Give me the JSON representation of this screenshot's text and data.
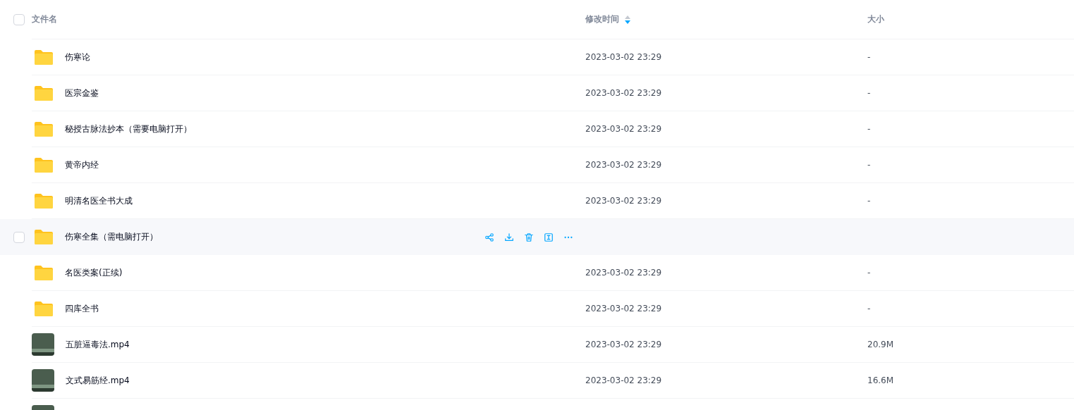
{
  "header": {
    "select_all_checked": false,
    "columns": [
      {
        "label": "文件名"
      },
      {
        "label": "修改时间",
        "sorted_descending": true
      },
      {
        "label": "大小"
      }
    ]
  },
  "rows": [
    {
      "kind": "folder",
      "name": "伤寒论",
      "modified": "2023-03-02 23:29",
      "size": "-",
      "hovered": false
    },
    {
      "kind": "folder",
      "name": "医宗金鉴",
      "modified": "2023-03-02 23:29",
      "size": "-",
      "hovered": false
    },
    {
      "kind": "folder",
      "name": "秘授古脉法抄本（需要电脑打开）",
      "modified": "2023-03-02 23:29",
      "size": "-",
      "hovered": false
    },
    {
      "kind": "folder",
      "name": "黄帝内经",
      "modified": "2023-03-02 23:29",
      "size": "-",
      "hovered": false
    },
    {
      "kind": "folder",
      "name": "明清名医全书大成",
      "modified": "2023-03-02 23:29",
      "size": "-",
      "hovered": false
    },
    {
      "kind": "folder",
      "name": "伤寒全集（需电脑打开）",
      "hovered": true,
      "checked": false
    },
    {
      "kind": "folder",
      "name": "名医类案(正续)",
      "modified": "2023-03-02 23:29",
      "size": "-",
      "hovered": false
    },
    {
      "kind": "folder",
      "name": "四库全书",
      "modified": "2023-03-02 23:29",
      "size": "-",
      "hovered": false
    },
    {
      "kind": "video",
      "name": "五脏逼毒法.mp4",
      "modified": "2023-03-02 23:29",
      "size": "20.9M",
      "hovered": false
    },
    {
      "kind": "video",
      "name": "文式易筋经.mp4",
      "modified": "2023-03-02 23:29",
      "size": "16.6M",
      "hovered": false
    },
    {
      "kind": "video",
      "hovered": false
    }
  ]
}
